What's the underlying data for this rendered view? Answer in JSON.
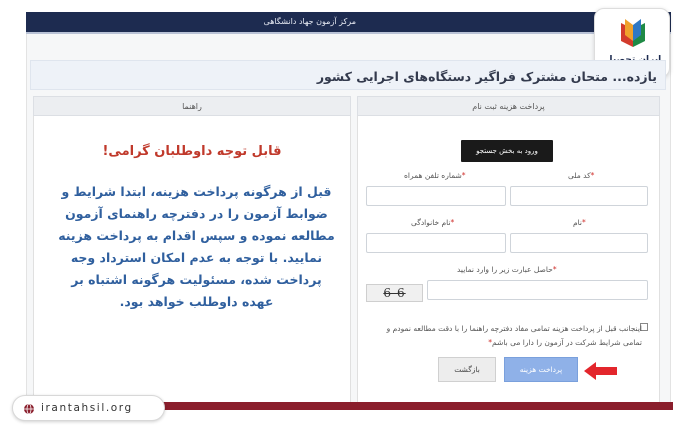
{
  "topbar": {
    "title": "مرکز آزمون جهاد دانشگاهی"
  },
  "brand": {
    "badge_text": "ایران تحصیل",
    "site": "irantahsil.org"
  },
  "exam": {
    "title_partial": "آزمون استخدامی مشترک فراگیر دستگاه‌های اجرایی کشور",
    "title_visible": "یازده... متحان مشترک فراگیر دستگاه‌های اجرایی کشور"
  },
  "guide": {
    "header": "راهنما",
    "attention": "قابل توجه داوطلبان گرامی!",
    "body": "قبل از هرگونه پرداخت هزینه، ابتدا شرایط و ضوابط آزمون را در دفترچه راهنمای آزمون مطالعه نموده و سپس اقدام به پرداخت هزینه نمایید. با توجه به عدم امکان استرداد وجه پرداخت شده، مسئولیت هرگونه اشتباه بر عهده داوطلب خواهد بود."
  },
  "form": {
    "header": "پرداخت هزینه ثبت نام",
    "enter_search": "ورود به بخش جستجو",
    "national_code": "کد ملی",
    "phone": "شماره تلفن همراه",
    "first_name": "نام",
    "last_name": "نام خانوادگی",
    "captcha_label": "حاصل عبارت زیر را وارد نمایید",
    "captcha_text": "6-6",
    "agree_text": "اینجانب قبل از پرداخت هزینه تمامی مفاد دفترچه راهنما را با دقت مطالعه نمودم و تمامی شرایط شرکت در آزمون را دارا می باشم",
    "required_mark": "*",
    "back_label": "بازگشت",
    "pay_label": "پرداخت هزینه"
  },
  "colors": {
    "topbar": "#1d2b50",
    "accent_red": "#c0392b",
    "guide_blue": "#2f5f9e",
    "pay_button": "#8fb1e8",
    "bottom_bar": "#8a1e2c"
  }
}
